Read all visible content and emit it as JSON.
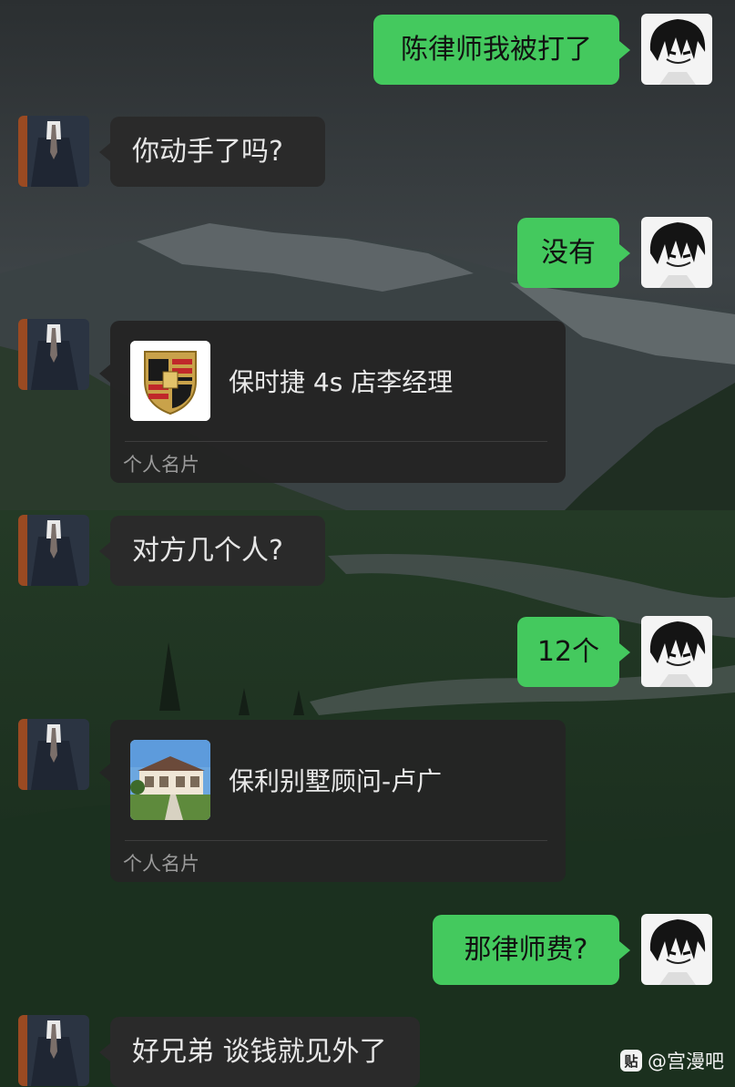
{
  "conversation": {
    "messages": [
      {
        "side": "out",
        "text": "陈律师我被打了"
      },
      {
        "side": "in",
        "text": "你动手了吗?"
      },
      {
        "side": "out",
        "text": "没有"
      },
      {
        "side": "in",
        "type": "card",
        "name": "保时捷 4s 店李经理",
        "kind": "个人名片",
        "thumb_icon": "porsche-crest-icon"
      },
      {
        "side": "in",
        "text": "对方几个人?"
      },
      {
        "side": "out",
        "text": "12个"
      },
      {
        "side": "in",
        "type": "card",
        "name": "保利别墅顾问-卢广",
        "kind": "个人名片",
        "thumb_icon": "villa-photo-icon"
      },
      {
        "side": "out",
        "text": "那律师费?"
      },
      {
        "side": "in",
        "text": "好兄弟 谈钱就见外了"
      }
    ]
  },
  "watermark": {
    "icon_glyph": "贴",
    "label": "@宫漫吧"
  },
  "colors": {
    "outgoing_bubble": "#44c95e",
    "incoming_bubble": "#2a2a2a",
    "card_bg": "#242424"
  }
}
